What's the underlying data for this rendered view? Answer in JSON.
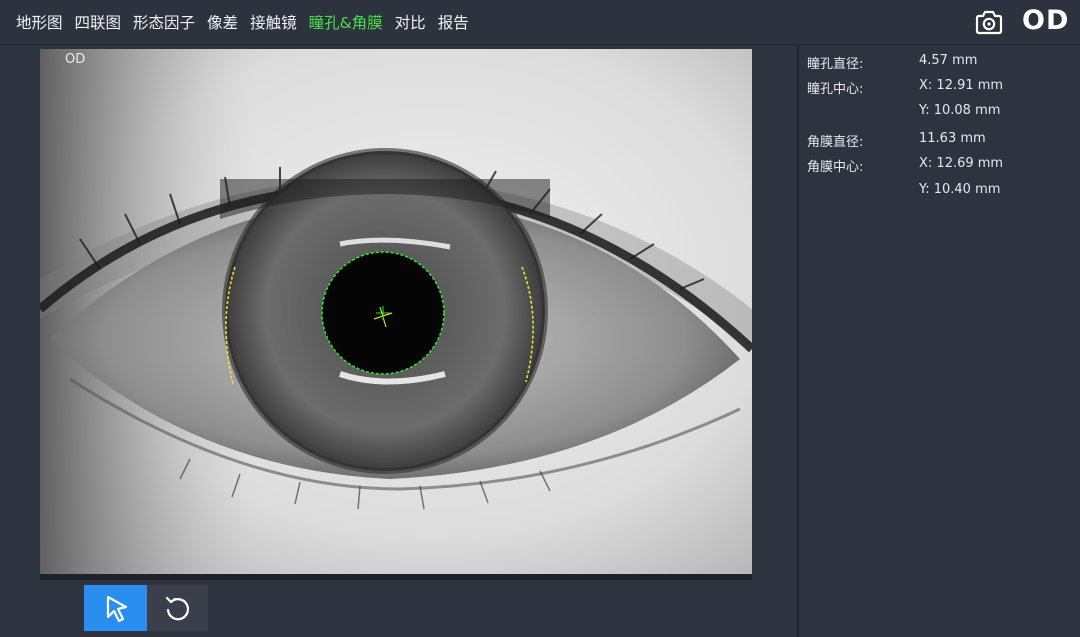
{
  "tabs": [
    {
      "label": "地形图",
      "active": false
    },
    {
      "label": "四联图",
      "active": false
    },
    {
      "label": "形态因子",
      "active": false
    },
    {
      "label": "像差",
      "active": false
    },
    {
      "label": "接触镜",
      "active": false
    },
    {
      "label": "瞳孔&角膜",
      "active": true
    },
    {
      "label": "对比",
      "active": false
    },
    {
      "label": "报告",
      "active": false
    }
  ],
  "header": {
    "camera_icon": "camera-icon",
    "eye_label": "OD"
  },
  "image": {
    "corner_label": "OD",
    "pupil_outline_color": "#2ee02e",
    "limbus_outline_color": "#e6e632"
  },
  "measurements": {
    "pupil_diameter_label": "瞳孔直径:",
    "pupil_diameter_value": "4.57 mm",
    "pupil_center_label": "瞳孔中心:",
    "pupil_center_x": "X: 12.91 mm",
    "pupil_center_y": "Y: 10.08 mm",
    "cornea_diameter_label": "角膜直径:",
    "cornea_diameter_value": "11.63 mm",
    "cornea_center_label": "角膜中心:",
    "cornea_center_x": "X: 12.69 mm",
    "cornea_center_y": "Y: 10.40 mm"
  },
  "tools": {
    "select_icon": "cursor-arrow-icon",
    "reset_icon": "rotate-reset-icon",
    "active_color": "#2a8ef0"
  }
}
